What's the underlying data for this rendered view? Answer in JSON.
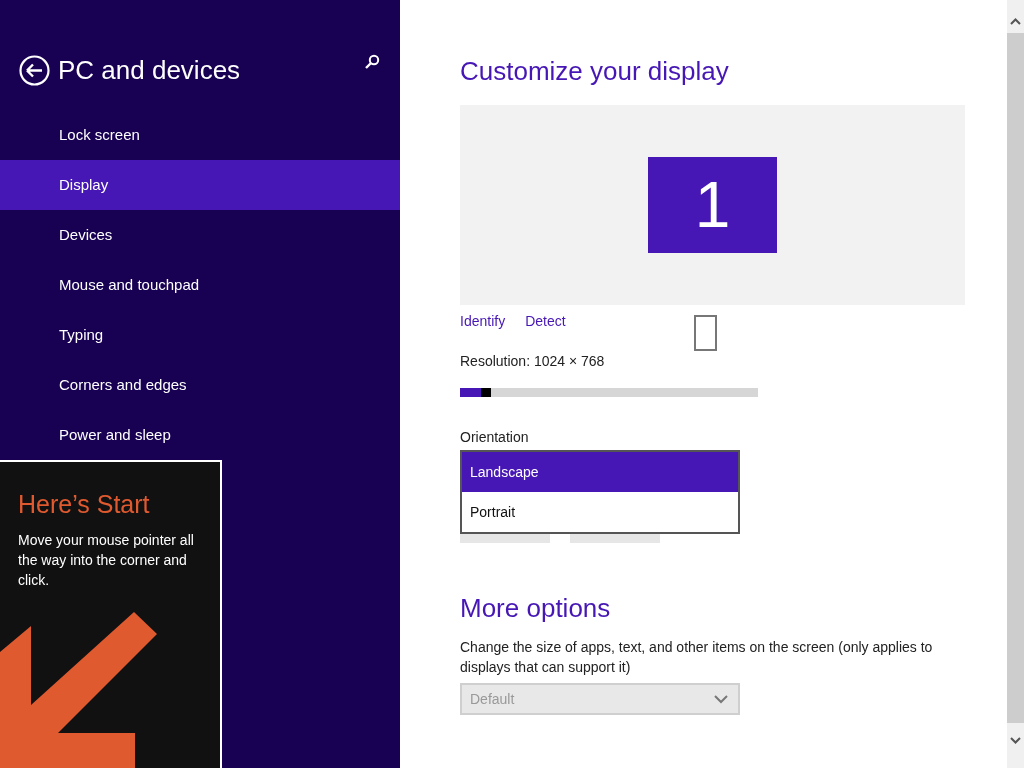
{
  "sidebar": {
    "title": "PC and devices",
    "items": [
      {
        "label": "Lock screen",
        "selected": false
      },
      {
        "label": "Display",
        "selected": true
      },
      {
        "label": "Devices",
        "selected": false
      },
      {
        "label": "Mouse and touchpad",
        "selected": false
      },
      {
        "label": "Typing",
        "selected": false
      },
      {
        "label": "Corners and edges",
        "selected": false
      },
      {
        "label": "Power and sleep",
        "selected": false
      }
    ]
  },
  "start_tip": {
    "title": "Here’s Start",
    "text": "Move your mouse pointer all the way into the corner and click."
  },
  "main": {
    "title": "Customize your display",
    "monitor_number": "1",
    "links": [
      "Identify",
      "Detect"
    ],
    "resolution": {
      "label": "Resolution: 1024 × 768",
      "level": 0.07
    },
    "orientation": {
      "label": "Orientation",
      "options": [
        {
          "label": "Landscape",
          "selected": true
        },
        {
          "label": "Portrait",
          "selected": false
        }
      ]
    },
    "more_options": {
      "title": "More options",
      "text": "Change the size of apps, text, and other items on the screen (only applies to displays that can support it)",
      "dropdown": {
        "value": "Default",
        "disabled": true
      }
    }
  }
}
